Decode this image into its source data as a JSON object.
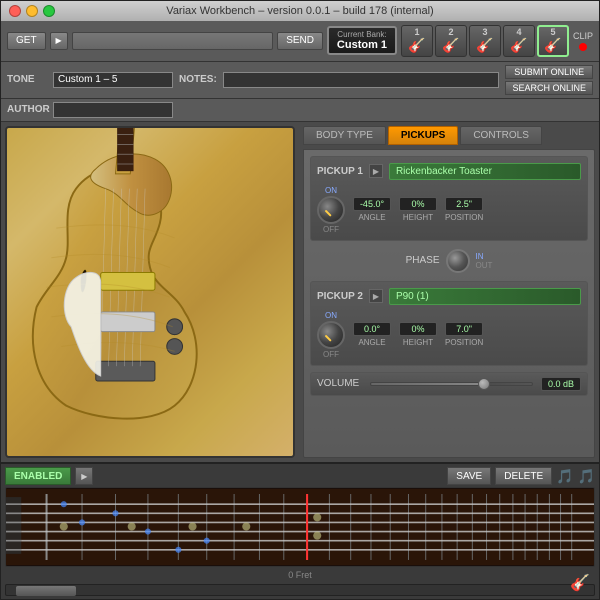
{
  "window": {
    "title": "Variax Workbench – version 0.0.1 – build 178 (internal)"
  },
  "toolbar": {
    "get_label": "GET",
    "send_label": "SEND",
    "current_bank_label": "Current Bank:",
    "current_bank_name": "Custom 1",
    "clip_label": "CLIP",
    "presets": [
      {
        "num": "1",
        "active": false
      },
      {
        "num": "2",
        "active": false
      },
      {
        "num": "3",
        "active": false
      },
      {
        "num": "4",
        "active": false
      },
      {
        "num": "5",
        "active": true
      }
    ]
  },
  "tone": {
    "tone_label": "TONE",
    "tone_value": "Custom 1 – 5",
    "author_label": "AUTHOR",
    "author_value": "",
    "notes_label": "NOTES:",
    "notes_value": "",
    "submit_label": "SUBMIT ONLINE",
    "search_label": "SEARCH ONLINE"
  },
  "tabs": {
    "body_type": "BODY TYPE",
    "pickups": "PICKUPS",
    "controls": "CONTROLS"
  },
  "pickup1": {
    "label": "PICKUP 1",
    "name": "Rickenbacker Toaster",
    "on_label": "ON",
    "off_label": "OFF",
    "angle_value": "-45.0°",
    "angle_label": "ANGLE",
    "height_value": "0%",
    "height_label": "HEIGHT",
    "position_value": "2.5\"",
    "position_label": "POSITION"
  },
  "phase": {
    "label": "PHASE",
    "in_label": "IN",
    "out_label": "OUT"
  },
  "pickup2": {
    "label": "PICKUP 2",
    "name": "P90 (1)",
    "on_label": "ON",
    "off_label": "OFF",
    "angle_value": "0.0°",
    "angle_label": "ANGLE",
    "height_value": "0%",
    "height_label": "HEIGHT",
    "position_value": "7.0\"",
    "position_label": "POSITION"
  },
  "volume": {
    "label": "VOLUME",
    "value": "0.0 dB"
  },
  "bottom": {
    "enabled_label": "ENABLED",
    "save_label": "SAVE",
    "delete_label": "DELETE",
    "fret_label": "0 Fret"
  }
}
